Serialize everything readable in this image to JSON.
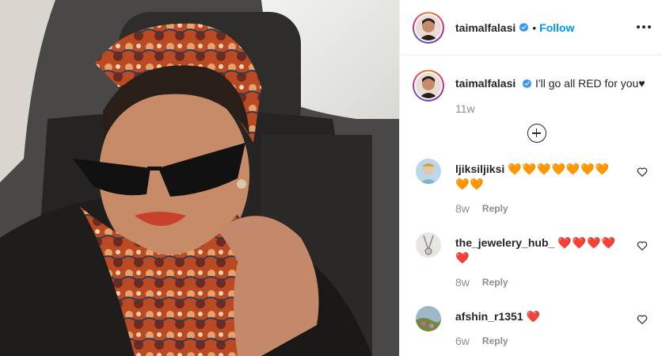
{
  "header": {
    "username": "taimalfalasi",
    "separator": "•",
    "follow_label": "Follow"
  },
  "caption": {
    "username": "taimalfalasi",
    "text": "I'll go all RED for you♥",
    "time": "11w"
  },
  "comments": [
    {
      "username": "ljiksiljiksi",
      "text": "🧡🧡🧡🧡🧡🧡🧡🧡🧡",
      "time": "8w",
      "reply_label": "Reply",
      "heart_color": "#e8641b"
    },
    {
      "username": "the_jewelery_hub_",
      "text": "❤️❤️❤️❤️❤️",
      "time": "8w",
      "reply_label": "Reply",
      "heart_color": "#e0162b"
    },
    {
      "username": "afshin_r1351",
      "text": "❤️",
      "time": "6w",
      "reply_label": "Reply",
      "heart_color": "#e0162b"
    }
  ],
  "icons": {
    "verified": "verified-badge-icon",
    "more": "more-options-icon",
    "load_more": "plus-circle-icon",
    "like": "heart-outline-icon"
  },
  "colors": {
    "link_blue": "#0095f6",
    "verified_blue": "#3897f0",
    "muted": "#8e8e8e"
  }
}
